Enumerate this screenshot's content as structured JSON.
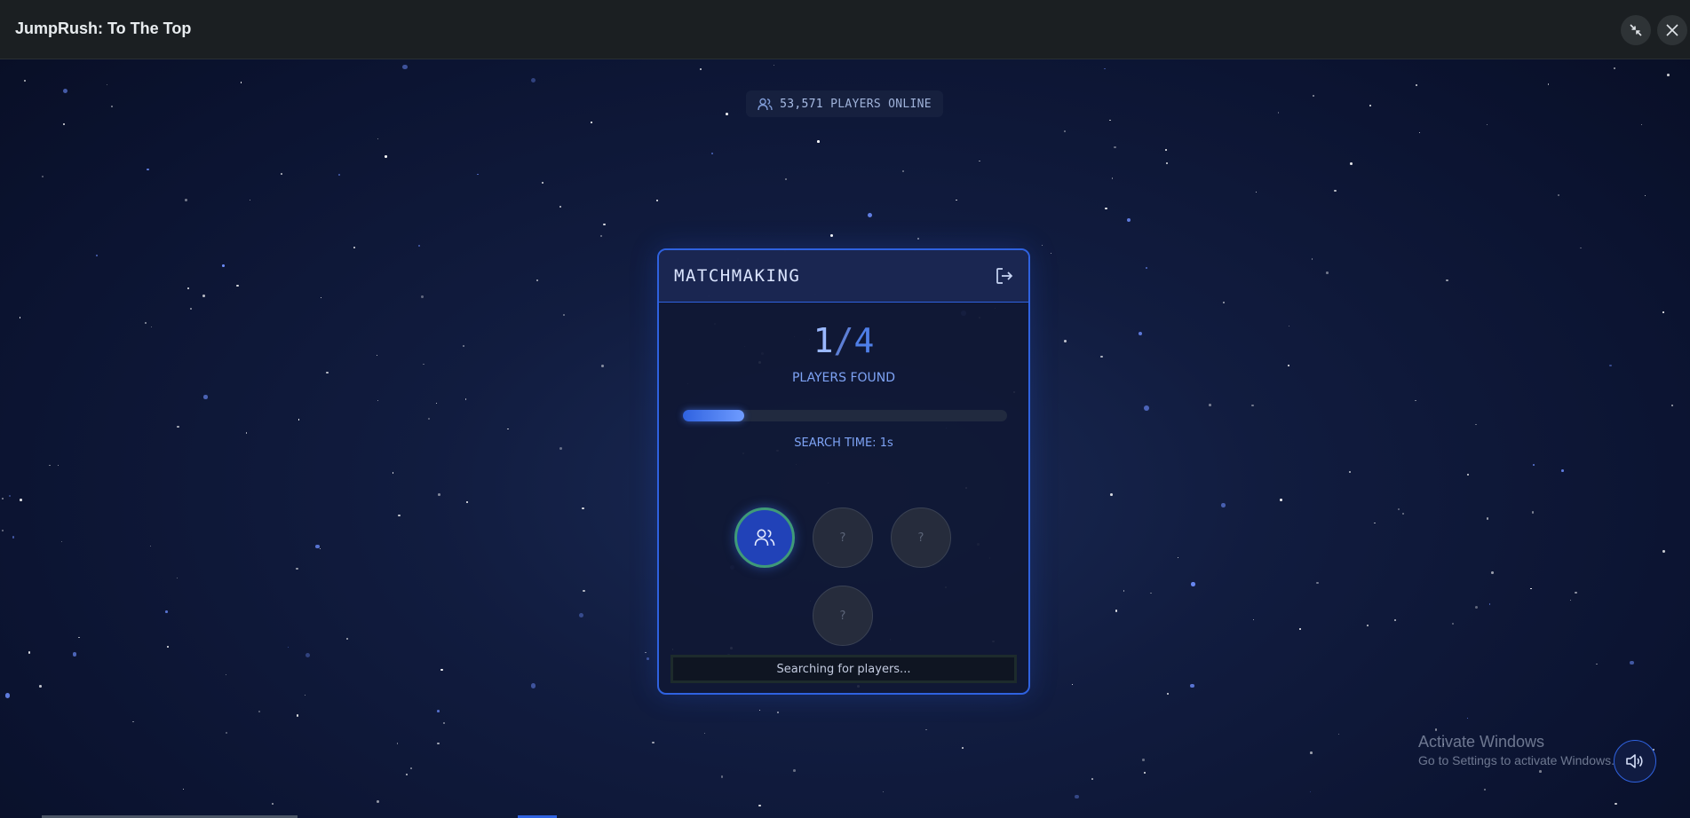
{
  "window": {
    "title": "JumpRush: To The Top"
  },
  "lobby": {
    "players_online_count": "53,571",
    "players_online_label": "PLAYERS ONLINE"
  },
  "matchmaking": {
    "title": "MATCHMAKING",
    "found_count": "1",
    "separator": "/",
    "total_slots": "4",
    "found_label": "PLAYERS FOUND",
    "progress_fraction": 0.19,
    "search_time_label": "SEARCH TIME: 1s",
    "slots": [
      {
        "state": "filled",
        "text": ""
      },
      {
        "state": "empty",
        "text": "?"
      },
      {
        "state": "empty",
        "text": "?"
      },
      {
        "state": "empty",
        "text": "?"
      }
    ],
    "status_text": "Searching for players..."
  },
  "watermark": {
    "title": "Activate Windows",
    "subtitle": "Go to Settings to activate Windows."
  },
  "colors": {
    "accent": "#2f62e0",
    "filled_slot": "#2142b8",
    "filled_slot_ring": "#3f9a78"
  },
  "icons": {
    "collapse": "collapse-arrows-icon",
    "close": "close-icon",
    "online": "users-icon",
    "exit": "exit-icon",
    "player": "users-icon",
    "sound": "speaker-icon"
  }
}
